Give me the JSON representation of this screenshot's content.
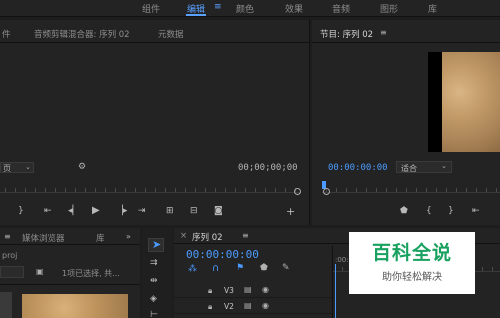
{
  "workspaces": [
    "组件",
    "编辑",
    "颜色",
    "效果",
    "音频",
    "图形",
    "库"
  ],
  "active_workspace": "编辑",
  "menu_icon": "hamburger-icon",
  "source_panel": {
    "tab_left": "件",
    "tab_mixer": "音频剪辑混合器: 序列 02",
    "tab_meta": "元数据",
    "zoom_value": "页",
    "timecode": "00;00;00;00"
  },
  "program_panel": {
    "title": "节目: 序列 02",
    "timecode": "00:00:00:00",
    "fit_label": "适合"
  },
  "project_panel": {
    "tab_browser": "媒体浏览器",
    "tab_library": "库",
    "file_name": "proj",
    "selection_info": "1项已选择, 共..."
  },
  "timeline_panel": {
    "close": "×",
    "sequence_tab": "序列 02",
    "timecode": "00:00:00:00",
    "ruler_start": ":00:0",
    "tracks": [
      {
        "name": "V3"
      },
      {
        "name": "V2"
      }
    ]
  },
  "watermark": {
    "title": "百科全说",
    "subtitle": "助你轻松解决"
  }
}
